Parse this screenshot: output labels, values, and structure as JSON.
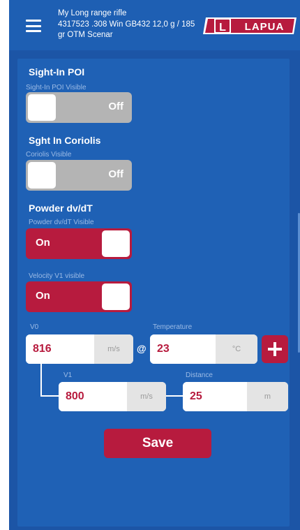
{
  "header": {
    "menu_icon": "hamburger-menu-icon",
    "rifle_name": "My Long range rifle",
    "rifle_details": "4317523 .308 Win GB432 12,0 g / 185 gr  OTM Scenar",
    "logo_text": "LAPUA",
    "logo_letter": "L"
  },
  "sections": {
    "sight_in": {
      "title": "Sight-In POI",
      "subtitle": "Sight-In POI Visible",
      "toggle_label": "Off",
      "on": false
    },
    "coriolis": {
      "title": "Sght In Coriolis",
      "subtitle": "Coriolis Visible",
      "toggle_label": "Off",
      "on": false
    },
    "powder": {
      "title": "Powder dv/dT",
      "subtitle": "Powder dv/dT Visible",
      "toggle_label": "On",
      "on": true
    },
    "velocity_v1": {
      "subtitle": "Velocity V1 visible",
      "toggle_label": "On",
      "on": true
    }
  },
  "fields": {
    "v0": {
      "label": "V0",
      "value": "816",
      "unit": "m/s"
    },
    "at_symbol": "@",
    "temperature": {
      "label": "Temperature",
      "value": "23",
      "unit": "°C"
    },
    "v1": {
      "label": "V1",
      "value": "800",
      "unit": "m/s"
    },
    "distance": {
      "label": "Distance",
      "value": "25",
      "unit": "m"
    }
  },
  "buttons": {
    "save_label": "Save",
    "plus_icon": "plus-icon"
  },
  "colors": {
    "background": "#1c55a6",
    "accent": "#b71b3e",
    "toggle_off": "#b4b4b4",
    "header": "#1e5fb3"
  }
}
